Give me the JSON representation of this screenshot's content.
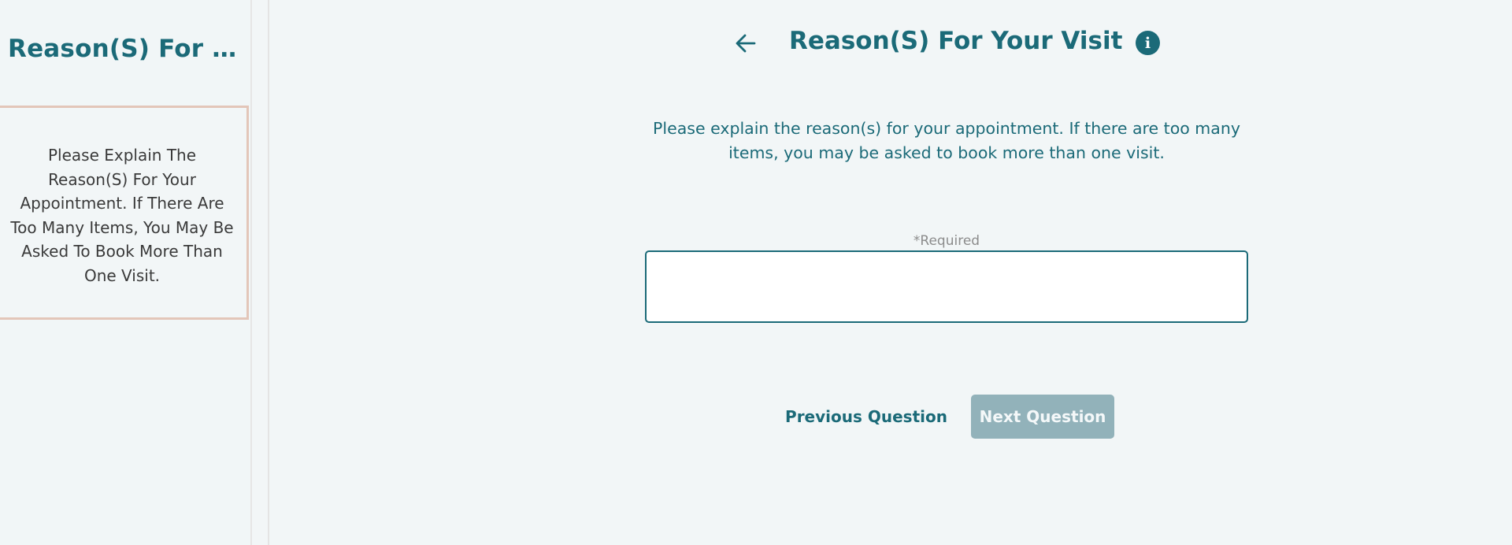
{
  "sidebar": {
    "title": "Reason(S) For Y...",
    "card_text": "Please Explain The Reason(S) For Your Appointment. If There Are Too Many Items, You May Be Asked To Book More Than One Visit."
  },
  "header": {
    "back_icon": "arrow-left-icon",
    "title": "Reason(S) For Your Visit",
    "info_icon": "info-icon",
    "info_glyph": "i"
  },
  "main": {
    "instructions": "Please explain the reason(s) for your appointment. If there are too many items, you may be asked to book more than one visit.",
    "required_label": "*Required",
    "reason_value": "",
    "reason_placeholder": ""
  },
  "buttons": {
    "previous_label": "Previous Question",
    "next_label": "Next Question",
    "next_disabled": true
  },
  "colors": {
    "brand": "#1b6a78",
    "card_border": "#e3c6b9",
    "disabled_button": "#92b2ba",
    "background": "#f2f6f7"
  }
}
